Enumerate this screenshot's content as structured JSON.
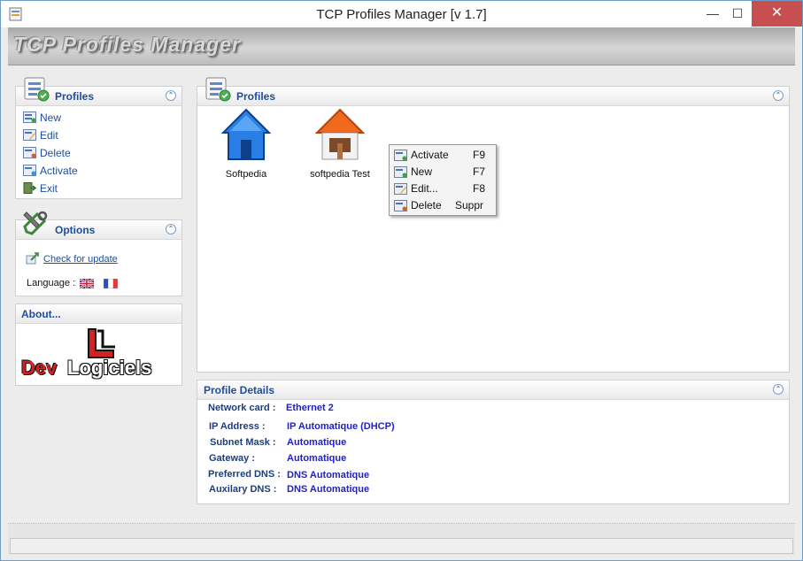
{
  "window": {
    "title": "TCP Profiles Manager [v 1.7]",
    "min_icon": "minimize-icon",
    "max_icon": "maximize-icon",
    "close_icon": "close-icon"
  },
  "banner": {
    "title": "TCP Profiles Manager"
  },
  "tasks": {
    "title": "Profiles",
    "items": [
      {
        "label": "New",
        "icon": "new-profile-icon"
      },
      {
        "label": "Edit",
        "icon": "edit-profile-icon"
      },
      {
        "label": "Delete",
        "icon": "delete-profile-icon"
      },
      {
        "label": "Activate",
        "icon": "activate-profile-icon"
      },
      {
        "label": "Exit",
        "icon": "exit-icon"
      }
    ]
  },
  "options": {
    "title": "Options",
    "check_update": "Check for update",
    "language_label": "Language :"
  },
  "about": {
    "title": "About...",
    "logo_text_1": "Dev",
    "logo_text_2": "Logiciels"
  },
  "profiles_panel": {
    "title": "Profiles",
    "profiles": [
      {
        "name": "Softpedia",
        "icon": "blue-house-icon"
      },
      {
        "name": "softpedia Test",
        "icon": "orange-house-icon"
      }
    ]
  },
  "context_menu": {
    "items": [
      {
        "label": "Activate",
        "key": "F9"
      },
      {
        "label": "New",
        "key": "F7"
      },
      {
        "label": "Edit...",
        "key": "F8"
      },
      {
        "label": "Delete",
        "key": "Suppr"
      }
    ]
  },
  "details": {
    "title": "Profile Details",
    "rows": [
      {
        "label": "Network card :",
        "value": "Ethernet 2"
      },
      {
        "label": "IP Address :",
        "value": "IP Automatique (DHCP)"
      },
      {
        "label": "Subnet Mask :",
        "value": "Automatique"
      },
      {
        "label": "Gateway :",
        "value": "Automatique"
      },
      {
        "label": "Preferred DNS :",
        "value": "DNS Automatique"
      },
      {
        "label": "Auxilary DNS :",
        "value": "DNS Automatique"
      }
    ]
  },
  "colors": {
    "accent": "#1d4d9c",
    "value_blue": "#1f1fc4",
    "close_red": "#c74f4f"
  }
}
